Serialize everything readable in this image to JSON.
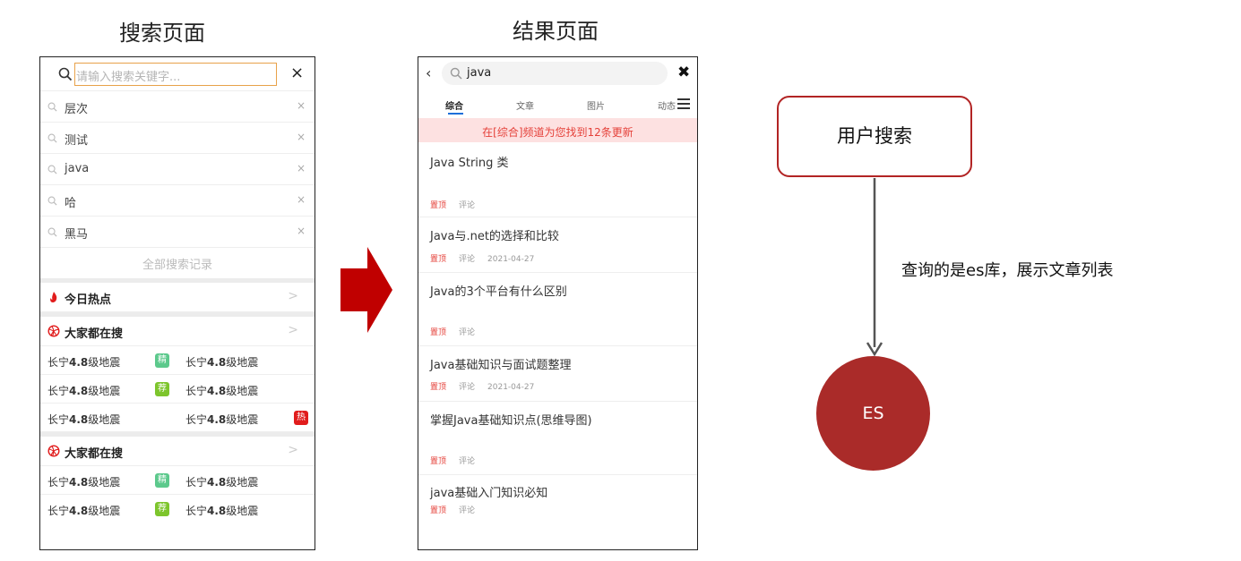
{
  "titles": {
    "search_page": "搜索页面",
    "result_page": "结果页面"
  },
  "search_page": {
    "placeholder": "请输入搜索关键字...",
    "history": [
      "层次",
      "测试",
      "java",
      "哈",
      "黑马"
    ],
    "history_delete": "×",
    "close": "×",
    "all_history": "全部搜索记录",
    "hot_today": "今日热点",
    "everyone_searching": "大家都在搜",
    "section_arrow": ">",
    "hot_item_prefix": "长宁",
    "hot_item_num": "4.8",
    "hot_item_suffix": "级地震",
    "badges": {
      "jing": "精",
      "jian": "荐",
      "re": "热"
    },
    "badge_colors": {
      "jing": "#5cc98c",
      "jian": "#7dc52c",
      "re": "#e11c1c"
    }
  },
  "result_page": {
    "query": "java",
    "back": "‹",
    "close": "✖",
    "tabs": [
      "综合",
      "文章",
      "图片",
      "动态"
    ],
    "banner": "在[综合]频道为您找到12条更新",
    "pin_label": "置顶",
    "comment_label": "评论",
    "results": [
      {
        "title": "Java String 类",
        "date": ""
      },
      {
        "title": "Java与.net的选择和比较",
        "date": "2021-04-27"
      },
      {
        "title": "Java的3个平台有什么区别",
        "date": ""
      },
      {
        "title": "Java基础知识与面试题整理",
        "date": "2021-04-27"
      },
      {
        "title": "掌握Java基础知识点(思维导图)",
        "date": ""
      },
      {
        "title": "java基础入门知识必知",
        "date": ""
      }
    ]
  },
  "flow": {
    "user_search": "用户搜索",
    "query_label": "查询的是es库，展示文章列表",
    "es": "ES"
  },
  "colors": {
    "accent_red": "#b22424",
    "es_fill": "#aa2b29",
    "arrow_red": "#c00000",
    "tab_underline": "#1e6fd9"
  }
}
